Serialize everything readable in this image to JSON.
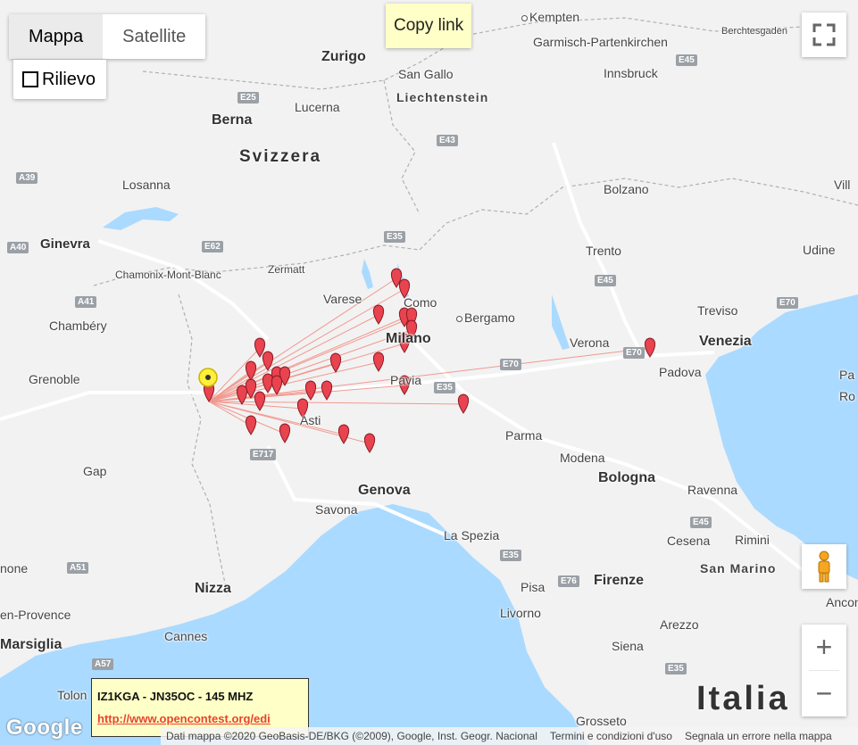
{
  "controls": {
    "map_type": [
      "Mappa",
      "Satellite"
    ],
    "terrain_label": "Rilievo",
    "copy_link": "Copy link",
    "zoom_in": "+",
    "zoom_out": "−"
  },
  "places": {
    "kempten": "Kempten",
    "garmisch": "Garmisch-Partenkirchen",
    "berchtesgaden": "Berchtesgaden",
    "zurigo": "Zurigo",
    "san_gallo": "San Gallo",
    "liechtenstein": "Liechtenstein",
    "innsbruck": "Innsbruck",
    "berna": "Berna",
    "lucerna": "Lucerna",
    "svizzera": "Svizzera",
    "losanna": "Losanna",
    "bolzano": "Bolzano",
    "vill": "Vill",
    "ginevra": "Ginevra",
    "trento": "Trento",
    "udine": "Udine",
    "zermatt": "Zermatt",
    "chamonix": "Chamonix-Mont-Blanc",
    "varese": "Varese",
    "como": "Como",
    "bergamo": "Bergamo",
    "treviso": "Treviso",
    "chambery": "Chambéry",
    "milano": "Milano",
    "verona": "Verona",
    "venezia": "Venezia",
    "padova": "Padova",
    "grenoble": "Grenoble",
    "pavia": "Pavia",
    "asti": "Asti",
    "parma": "Parma",
    "modena": "Modena",
    "bologna": "Bologna",
    "gap": "Gap",
    "genova": "Genova",
    "ravenna": "Ravenna",
    "savona": "Savona",
    "la_spezia": "La Spezia",
    "cesena": "Cesena",
    "rimini": "Rimini",
    "san_marino": "San Marino",
    "none": "none",
    "nizza": "Nizza",
    "pisa": "Pisa",
    "firenze": "Firenze",
    "en_provence": "en-Provence",
    "livorno": "Livorno",
    "cannes": "Cannes",
    "arezzo": "Arezzo",
    "marsiglia": "Marsiglia",
    "siena": "Siena",
    "italia": "Italia",
    "tolon": "Tolon",
    "grosseto": "Grosseto",
    "ancon": "Ancon",
    "pa": "Pa",
    "ro": "Ro"
  },
  "roads": [
    "E45",
    "E25",
    "E43",
    "A39",
    "E62",
    "E35",
    "A40",
    "A41",
    "E45",
    "E70",
    "E70",
    "E70",
    "E35",
    "E717",
    "E76",
    "A51",
    "A57",
    "E45",
    "E35",
    "E35"
  ],
  "infobox": {
    "title": "IZ1KGA - JN35OC - 145 MHZ",
    "link": "http://www.opencontest.org/edi"
  },
  "footer": {
    "logo": "Google",
    "data": "Dati mappa ©2020 GeoBasis-DE/BKG (©2009), Google, Inst. Geogr. Nacional",
    "terms": "Termini e condizioni d'uso",
    "report": "Segnala un errore nella mappa"
  },
  "colors": {
    "marker": "#e8434f",
    "home_marker": "#ffef3b",
    "link_line": "#f08a7e",
    "sea": "#aadaff"
  },
  "icons": [
    "fullscreen-icon",
    "pegman-icon",
    "marker-icon"
  ]
}
